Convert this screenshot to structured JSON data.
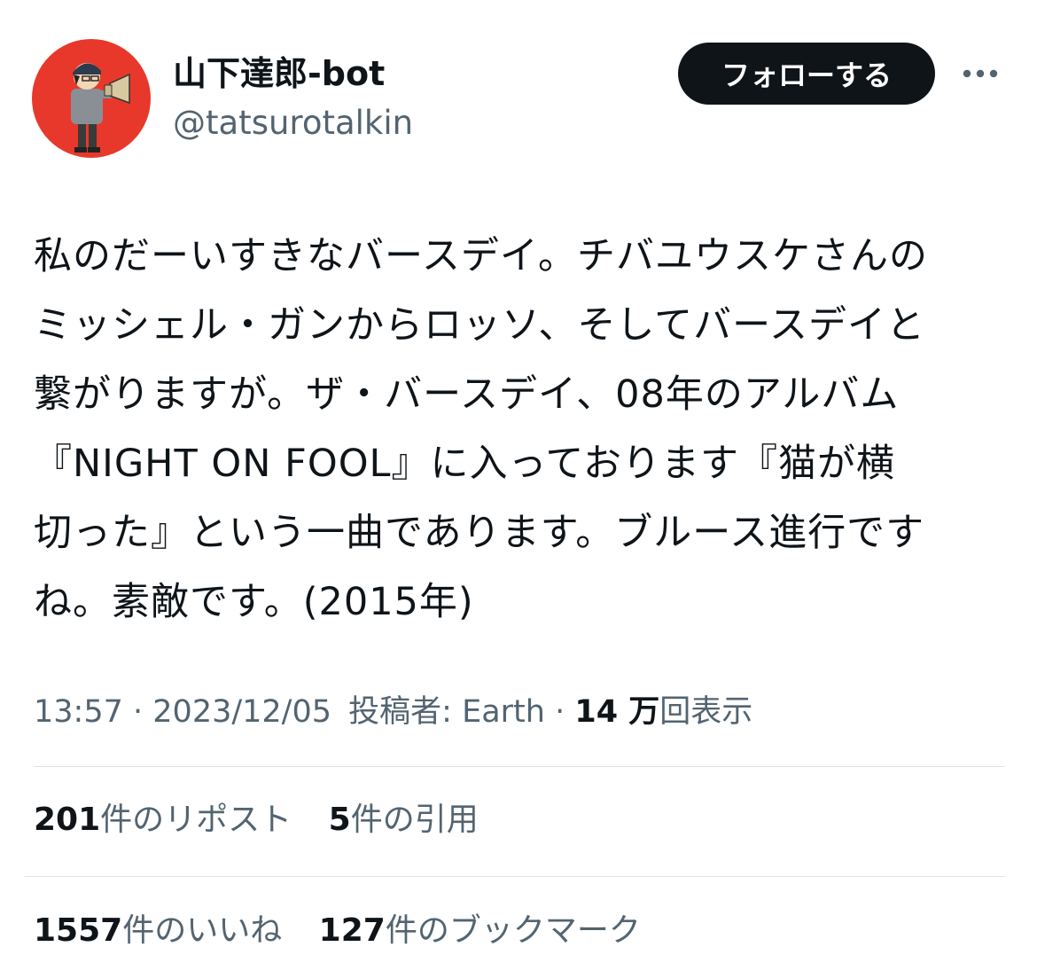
{
  "user": {
    "display_name": "山下達郎-bot",
    "handle": "@tatsurotalkin",
    "avatar_bg_color": "#e8382b"
  },
  "header": {
    "follow_label": "フォローする",
    "more_icon": "more-horizontal-icon"
  },
  "tweet": {
    "text": "私のだーいすきなバースデイ。チバユウスケさんの\nミッシェル・ガンからロッソ、そしてバースデイと\n繋がりますが。ザ・バースデイ、08年のアルバム\n『NIGHT ON FOOL』に入っております『猫が横\n切った』という一曲であります。ブルース進行です\nね。素敵です。(2015年)"
  },
  "meta": {
    "time": "13:57",
    "date": "2023/12/05",
    "posted_by": "投稿者: Earth",
    "views_count": "14 万",
    "views_label": "回表示"
  },
  "stats": {
    "reposts_count": "201",
    "reposts_label": "件のリポスト",
    "quotes_count": "5",
    "quotes_label": "件の引用",
    "likes_count": "1557",
    "likes_label": "件のいいね",
    "bookmarks_count": "127",
    "bookmarks_label": "件のブックマーク"
  },
  "colors": {
    "text_primary": "#0f1419",
    "text_secondary": "#536471",
    "button_bg": "#0f1419",
    "divider": "#dfe3e6"
  }
}
